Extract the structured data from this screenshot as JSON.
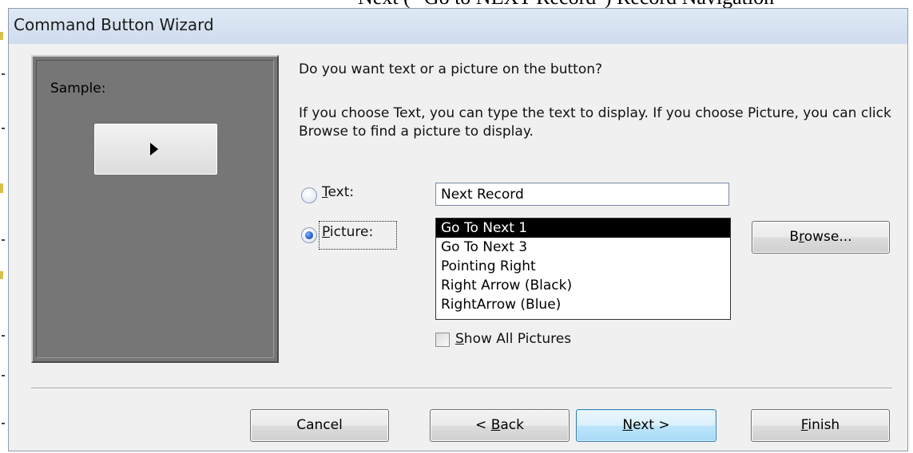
{
  "caption_fragment": "Next (\" Go to NEXT Record\") Record Navigation \"",
  "window": {
    "title": "Command Button Wizard"
  },
  "sample": {
    "label": "Sample:",
    "button_icon": "play-arrow-icon"
  },
  "prompt": {
    "question": "Do you want text or a picture on the button?",
    "instructions": "If you choose Text, you can type the text to display.  If you choose Picture, you can click Browse to find a picture to display."
  },
  "options": {
    "text": {
      "label_pre": "",
      "accel": "T",
      "label_post": "ext:",
      "checked": false,
      "value": "Next Record"
    },
    "picture": {
      "label_pre": "",
      "accel": "P",
      "label_post": "icture:",
      "checked": true
    }
  },
  "pictures": {
    "items": [
      "Go To Next 1",
      "Go To Next 3",
      "Pointing Right",
      "Right Arrow (Black)",
      "RightArrow (Blue)"
    ],
    "selected_index": 0
  },
  "browse_button": {
    "pre": "B",
    "accel": "r",
    "post": "owse..."
  },
  "show_all": {
    "pre": "",
    "accel": "S",
    "post": "how All Pictures",
    "checked": false
  },
  "footer": {
    "cancel": {
      "pre": "Cancel",
      "accel": "",
      "post": ""
    },
    "back": {
      "pre": "< ",
      "accel": "B",
      "post": "ack"
    },
    "next": {
      "pre": "",
      "accel": "N",
      "post": "ext >"
    },
    "finish": {
      "pre": "",
      "accel": "F",
      "post": "inish"
    }
  }
}
